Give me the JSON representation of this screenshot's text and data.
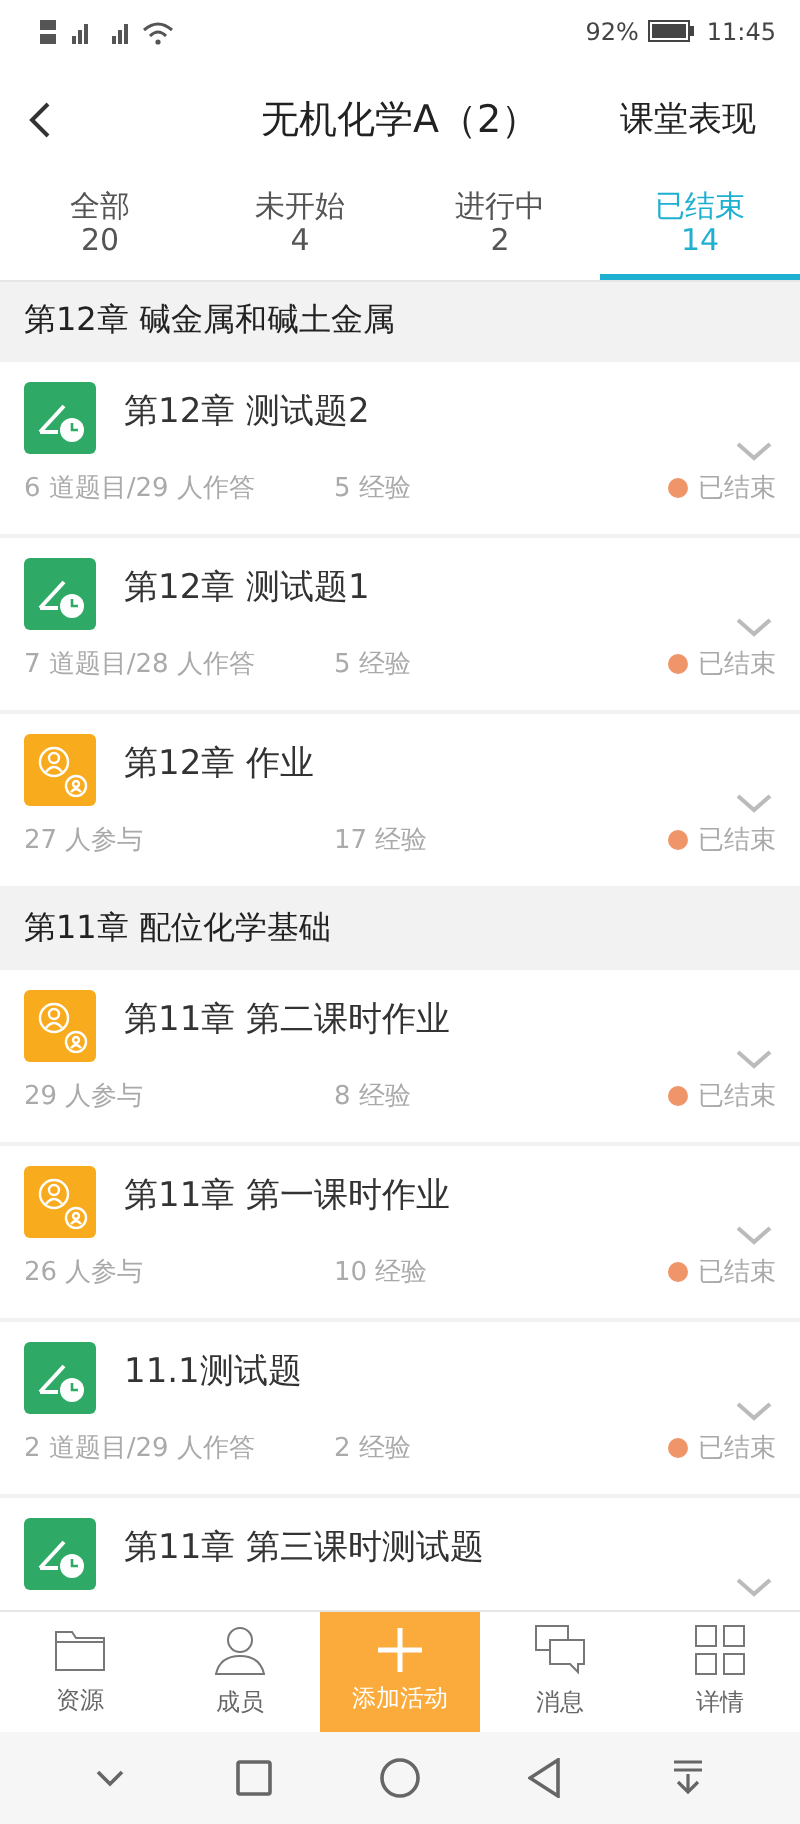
{
  "status_bar": {
    "battery": "92%",
    "time": "11:45"
  },
  "header": {
    "title": "无机化学A（2）",
    "action": "课堂表现"
  },
  "tabs": [
    {
      "label": "全部",
      "count": "20",
      "selected": false
    },
    {
      "label": "未开始",
      "count": "4",
      "selected": false
    },
    {
      "label": "进行中",
      "count": "2",
      "selected": false
    },
    {
      "label": "已结束",
      "count": "14",
      "selected": true
    }
  ],
  "sections": [
    {
      "title": "第12章 碱金属和碱土金属",
      "items": [
        {
          "kind": "quiz",
          "title": "第12章 测试题2",
          "meta": "6 道题目/29 人作答",
          "exp": "5 经验",
          "status": "已结束",
          "color": "#f0956a"
        },
        {
          "kind": "quiz",
          "title": "第12章 测试题1",
          "meta": "7 道题目/28 人作答",
          "exp": "5 经验",
          "status": "已结束",
          "color": "#f0956a"
        },
        {
          "kind": "homework",
          "title": "第12章 作业",
          "meta": "27 人参与",
          "exp": "17 经验",
          "status": "已结束",
          "color": "#f0956a"
        }
      ]
    },
    {
      "title": "第11章 配位化学基础",
      "items": [
        {
          "kind": "homework",
          "title": "第11章 第二课时作业",
          "meta": "29 人参与",
          "exp": "8 经验",
          "status": "已结束",
          "color": "#f0956a"
        },
        {
          "kind": "homework",
          "title": "第11章 第一课时作业",
          "meta": "26 人参与",
          "exp": "10 经验",
          "status": "已结束",
          "color": "#f0956a"
        },
        {
          "kind": "quiz",
          "title": "11.1测试题",
          "meta": "2 道题目/29 人作答",
          "exp": "2 经验",
          "status": "已结束",
          "color": "#f0956a"
        },
        {
          "kind": "quiz",
          "title": "第11章 第三课时测试题"
        }
      ]
    }
  ],
  "bottom_nav": [
    {
      "kind": "folder",
      "label": "资源",
      "selected": false
    },
    {
      "kind": "person",
      "label": "成员",
      "selected": false
    },
    {
      "kind": "plus",
      "label": "添加活动",
      "selected": true
    },
    {
      "kind": "chat",
      "label": "消息",
      "selected": false
    },
    {
      "kind": "grid",
      "label": "详情",
      "selected": false
    }
  ]
}
